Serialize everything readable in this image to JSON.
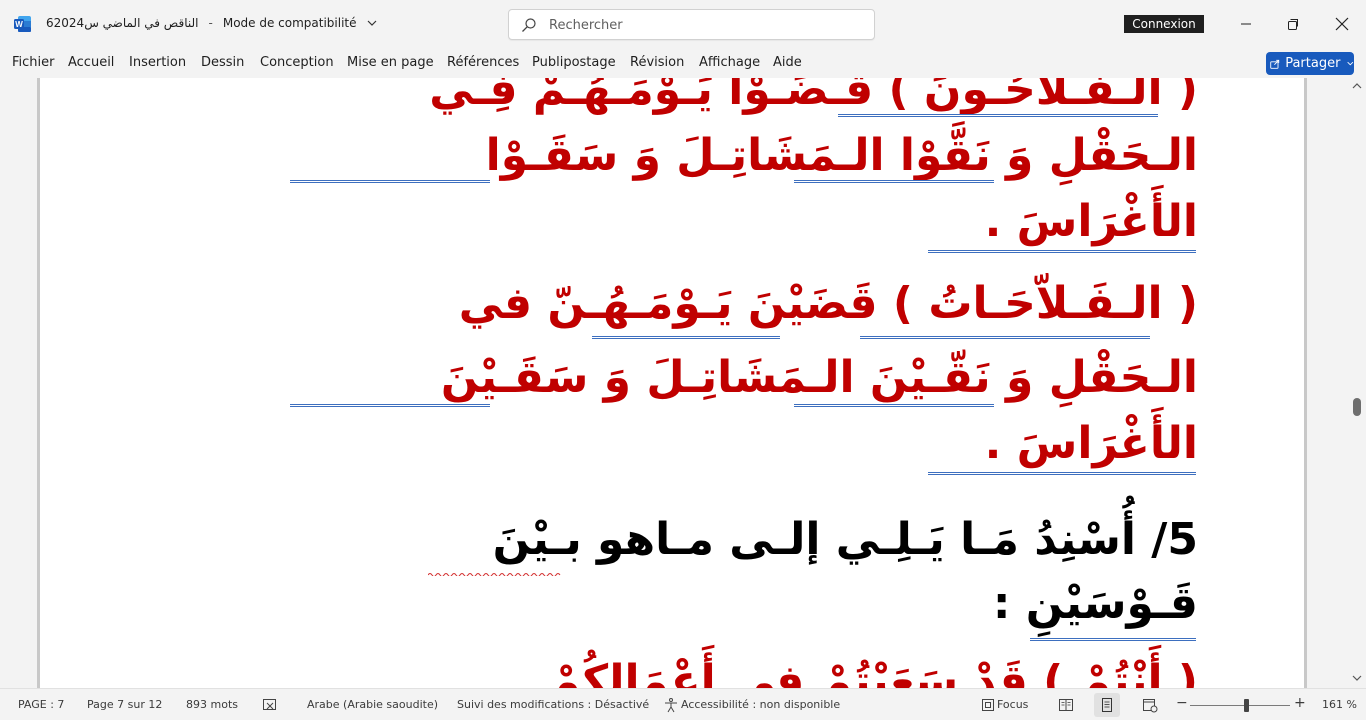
{
  "titlebar": {
    "doc_name": "الناقص في الماضي س62024",
    "separator": "-",
    "mode": "Mode de compatibilité",
    "search_placeholder": "Rechercher",
    "signin_label": "Connexion"
  },
  "menu": {
    "items": [
      "Fichier",
      "Accueil",
      "Insertion",
      "Dessin",
      "Conception",
      "Mise en page",
      "Références",
      "Publipostage",
      "Révision",
      "Affichage",
      "Aide"
    ],
    "share_label": "Partager"
  },
  "document": {
    "lines": [
      "( الـفـلاّحُـونَ )   قَـضَـوْا  يَـوْمَـهُـمْ  فِـي",
      "الـحَقْلِ  وَ  نَقَّوْا  الـمَشَاتِـلَ  وَ  سَقَـوْا",
      "الأَغْرَاسَ  .",
      "( الـفَـلاّحَـاتُ )   قَضَيْنَ  يَـوْمَـهُـنّ  في",
      "الـحَقْلِ  وَ  نَقّـيْنَ  الـمَشَاتِـلَ  وَ  سَقَـيْنَ",
      "الأَغْرَاسَ  .",
      "5/  أُسْنِدُ  مَـا  يَـلِـي  إلـى  مـاهو  بـيْنَ",
      "قَـوْسَيْنِ  :",
      "( أَنْتُمْ )  قَدْ  سَعَيْتُمْ  في  أَعْمَالِكُمْ"
    ]
  },
  "statusbar": {
    "page": "PAGE : 7",
    "page_of": "Page 7 sur 12",
    "words": "893 mots",
    "language": "Arabe (Arabie saoudite)",
    "track_changes": "Suivi des modifications : Désactivé",
    "accessibility": "Accessibilité : non disponible",
    "focus": "Focus",
    "zoom_minus": "−",
    "zoom_plus": "+",
    "zoom": "161 %",
    "zoom_level_percent": 161
  },
  "colors": {
    "red_text": "#c00000",
    "accent": "#185abd",
    "underline": "#3d6fbf"
  }
}
